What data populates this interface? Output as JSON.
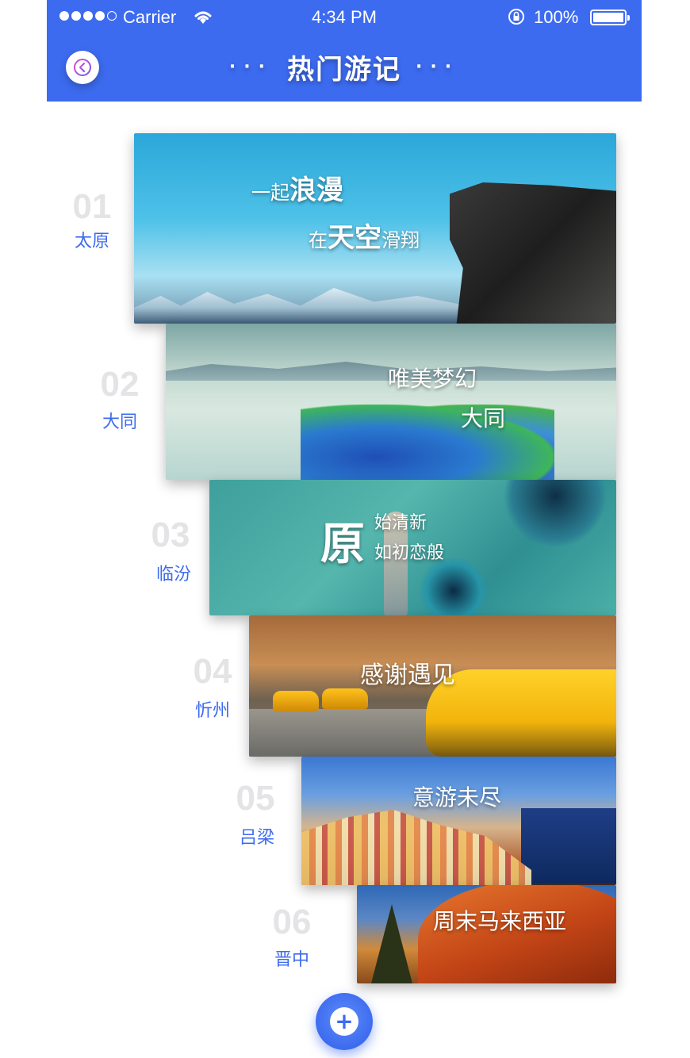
{
  "status_bar": {
    "carrier": "Carrier",
    "time": "4:34 PM",
    "battery": "100%",
    "signal_bars_filled": 4,
    "signal_bars_total": 5
  },
  "nav": {
    "title": "热门游记",
    "dots_left": "···",
    "dots_right": "···",
    "back_icon": "back-arrow-icon"
  },
  "entries": [
    {
      "number": "01",
      "city": "太原",
      "caption_line1": "一起",
      "caption_line1_big": "浪漫",
      "caption_line2_pre": "在",
      "caption_line2_big": "天空",
      "caption_line2_post": "滑翔"
    },
    {
      "number": "02",
      "city": "大同",
      "caption_line1": "唯美梦幻",
      "caption_line2": "大同"
    },
    {
      "number": "03",
      "city": "临汾",
      "caption_big": "原",
      "caption_line1": "始清新",
      "caption_line2": "如初恋般"
    },
    {
      "number": "04",
      "city": "忻州",
      "caption_line1": "感谢遇见"
    },
    {
      "number": "05",
      "city": "吕梁",
      "caption_line1": "意游未尽"
    },
    {
      "number": "06",
      "city": "晋中",
      "caption_line1": "周末马来西亚"
    }
  ],
  "add_button": {
    "icon": "plus-icon",
    "symbol": "+"
  },
  "colors": {
    "primary": "#3d6bf0",
    "number_gray": "#e4e4e6"
  }
}
